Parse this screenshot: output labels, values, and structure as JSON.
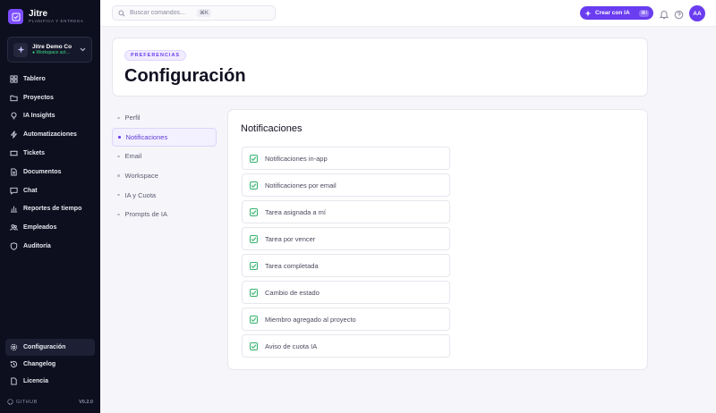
{
  "brand": {
    "name": "Jitre",
    "tagline": "PLANIFICA Y ENTREGA"
  },
  "workspace": {
    "name": "Jitre Demo Co",
    "status": "● Workspace act…"
  },
  "sidebar": {
    "items": [
      {
        "label": "Tablero",
        "icon": "grid-icon"
      },
      {
        "label": "Proyectos",
        "icon": "folder-icon"
      },
      {
        "label": "IA Insights",
        "icon": "lightbulb-icon"
      },
      {
        "label": "Automatizaciones",
        "icon": "bolt-icon"
      },
      {
        "label": "Tickets",
        "icon": "ticket-icon"
      },
      {
        "label": "Documentos",
        "icon": "document-icon"
      },
      {
        "label": "Chat",
        "icon": "chat-icon"
      },
      {
        "label": "Reportes de tiempo",
        "icon": "bar-chart-icon"
      },
      {
        "label": "Empleados",
        "icon": "users-icon"
      },
      {
        "label": "Auditoría",
        "icon": "shield-icon"
      }
    ],
    "bottom": [
      {
        "label": "Configuración",
        "icon": "gear-icon",
        "active": true
      },
      {
        "label": "Changelog",
        "icon": "history-icon"
      },
      {
        "label": "Licencia",
        "icon": "file-icon"
      }
    ],
    "footer": {
      "github": "GITHUB",
      "version": "V0.2.0"
    }
  },
  "topbar": {
    "search_placeholder": "Buscar comandos...",
    "search_shortcut": "⌘K",
    "ai_button_label": "Crear con IA",
    "ai_button_shortcut": "⌘I",
    "avatar_initials": "AA"
  },
  "header": {
    "pill": "PREFERENCIAS",
    "title": "Configuración"
  },
  "settings_nav": {
    "items": [
      "Perfil",
      "Notificaciones",
      "Email",
      "Workspace",
      "IA y Cuota",
      "Prompts de IA"
    ],
    "active": "Notificaciones"
  },
  "notifications": {
    "title": "Notificaciones",
    "items": [
      "Notificaciones in-app",
      "Notificaciones por email",
      "Tarea asignada a mí",
      "Tarea por vencer",
      "Tarea completada",
      "Cambio de estado",
      "Miembro agregado al proyecto",
      "Aviso de cuota IA"
    ]
  },
  "colors": {
    "accent": "#6a3df0",
    "sidebar_bg": "#0d0f1e",
    "check": "#3bb273"
  }
}
